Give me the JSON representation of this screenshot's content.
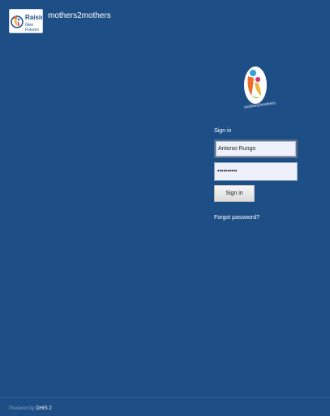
{
  "header": {
    "logo_line1": "Raising",
    "logo_line2": "New Futures",
    "title": "mothers2mothers"
  },
  "logo": {
    "caption": "mothers2mothers"
  },
  "login": {
    "signin_label": "Sign in",
    "username_value": "Antonio Rungo",
    "password_value": "••••••••••",
    "signin_button": "Sign in",
    "forgot_password": "Forgot password?"
  },
  "footer": {
    "powered_by": "Powered by",
    "dhis": "DHIS 2"
  },
  "colors": {
    "background": "#1d4f86",
    "field_bg": "#eef1fb"
  }
}
